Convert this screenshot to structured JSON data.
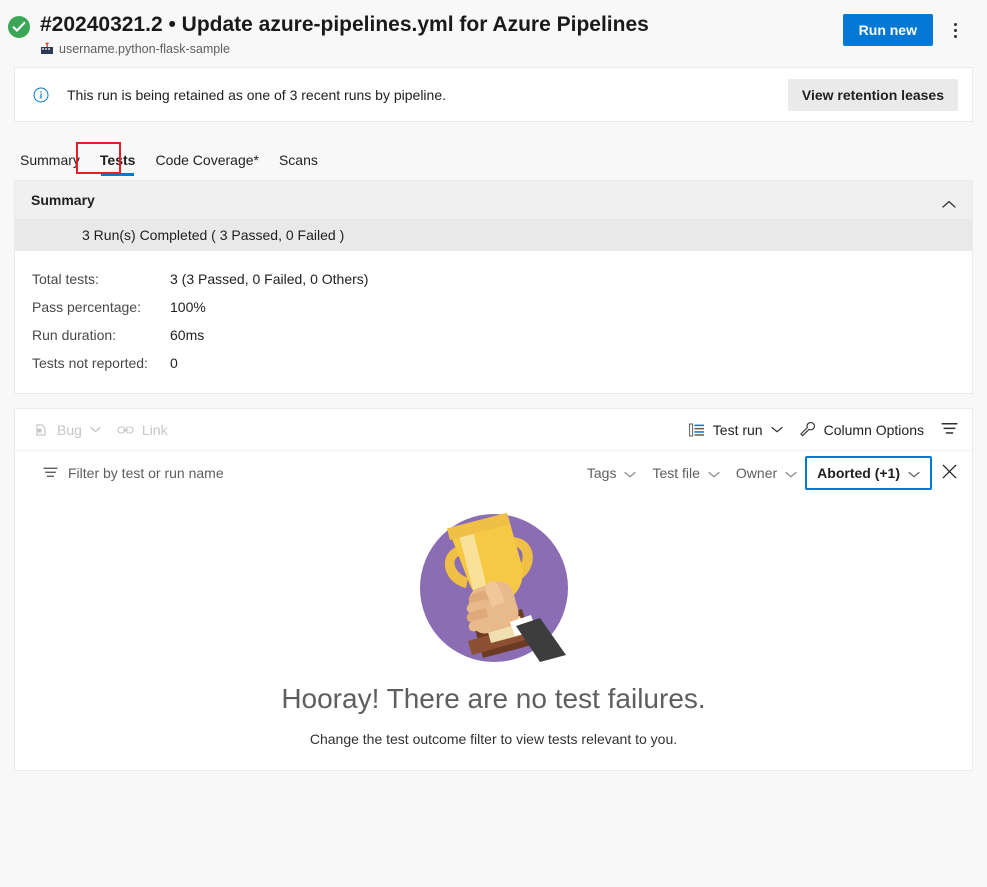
{
  "header": {
    "status_icon": "success-check-icon",
    "run_title": "#20240321.2 • Update azure-pipelines.yml for Azure Pipelines",
    "repo_icon": "github-repo-icon",
    "repo_name": "username.python-flask-sample",
    "run_new_label": "Run new",
    "more_actions_label": "More actions"
  },
  "banner": {
    "icon": "info-icon",
    "message": "This run is being retained as one of 3 recent runs by pipeline.",
    "action_label": "View retention leases"
  },
  "tabs": {
    "items": [
      {
        "label": "Summary",
        "selected": false
      },
      {
        "label": "Tests",
        "selected": true
      },
      {
        "label": "Code Coverage*",
        "selected": false
      },
      {
        "label": "Scans",
        "selected": false
      }
    ],
    "highlight_color": "#e31e24",
    "selected_underline_color": "#0078d4"
  },
  "summary": {
    "title": "Summary",
    "collapse_icon": "chevron-up-icon",
    "runs_line": "3 Run(s) Completed ( 3 Passed, 0 Failed )",
    "stats": [
      {
        "label": "Total tests:",
        "value": "3 (3 Passed, 0 Failed, 0 Others)"
      },
      {
        "label": "Pass percentage:",
        "value": "100%"
      },
      {
        "label": "Run duration:",
        "value": "60ms"
      },
      {
        "label": "Tests not reported:",
        "value": "0"
      }
    ]
  },
  "command_bar": {
    "bug_label": "Bug",
    "bug_icon": "bug-icon",
    "bug_chevron": "chevron-down-icon",
    "link_label": "Link",
    "link_icon": "link-icon",
    "grouping_label": "Test run",
    "grouping_icon": "group-list-icon",
    "grouping_chevron": "chevron-down-icon",
    "column_options_label": "Column Options",
    "column_options_icon": "wrench-icon",
    "filter_toggle_icon": "filter-icon"
  },
  "filter_bar": {
    "filter_icon": "filter-icon",
    "placeholder": "Filter by test or run name",
    "value": "",
    "dropdowns": [
      {
        "label": "Tags",
        "icon": "chevron-down-icon",
        "active": false
      },
      {
        "label": "Test file",
        "icon": "chevron-down-icon",
        "active": false
      },
      {
        "label": "Owner",
        "icon": "chevron-down-icon",
        "active": false
      },
      {
        "label": "Aborted (+1)",
        "icon": "chevron-down-icon",
        "active": true
      }
    ],
    "clear_icon": "close-icon",
    "active_border_color": "#0078d4"
  },
  "empty_state": {
    "illustration": "trophy-in-hand-illustration",
    "illustration_colors": {
      "circle": "#8b6db3",
      "trophy_gold": "#f2c94c",
      "trophy_gold_dark": "#e8b52e",
      "trophy_highlight": "#f8e4a0",
      "base_wood": "#6b3b24",
      "plaque": "#f0e0b0",
      "skin": "#e8b98a",
      "sleeve": "#3d3d3d"
    },
    "title": "Hooray! There are no test failures.",
    "subtitle": "Change the test outcome filter to view tests relevant to you."
  }
}
